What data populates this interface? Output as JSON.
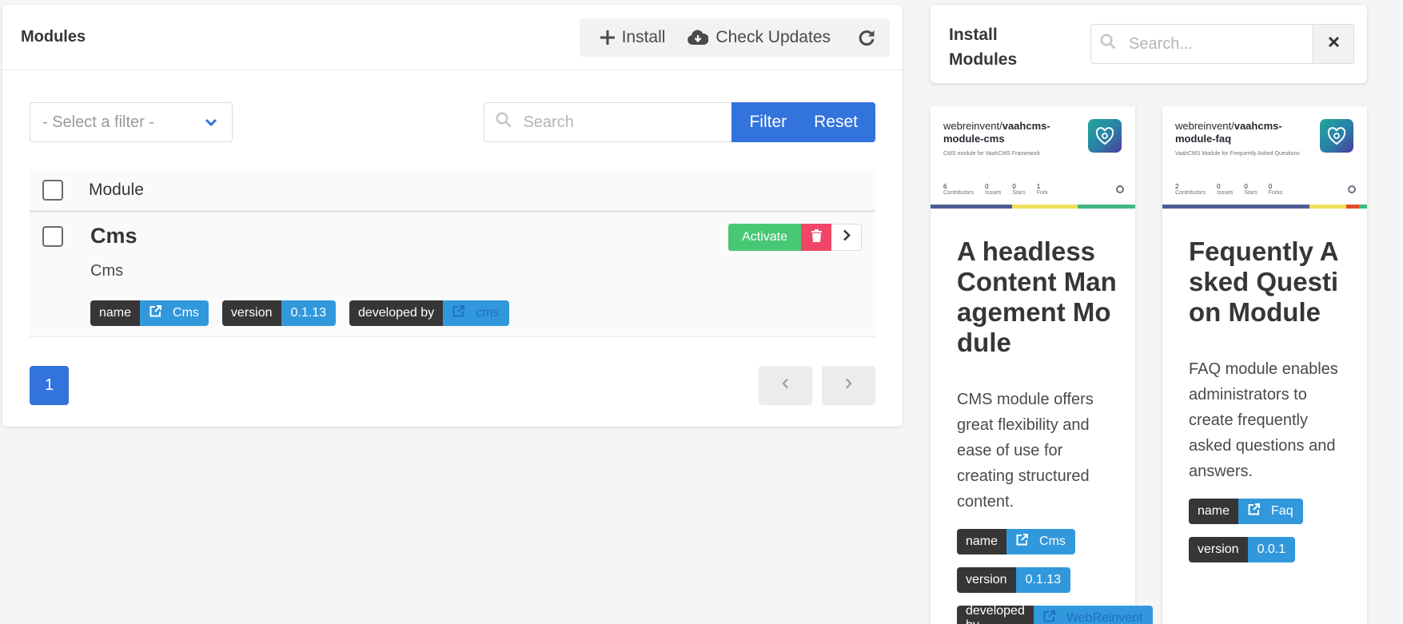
{
  "modules_panel": {
    "title": "Modules",
    "toolbar": {
      "install_label": "Install",
      "check_updates_label": "Check Updates"
    },
    "filter": {
      "select_placeholder": "- Select a filter -",
      "search_placeholder": "Search",
      "filter_label": "Filter",
      "reset_label": "Reset"
    },
    "table": {
      "column_module": "Module",
      "rows": [
        {
          "name": "Cms",
          "subtitle": "Cms",
          "activate_label": "Activate",
          "tags": [
            {
              "key": "name",
              "value": "Cms"
            },
            {
              "key": "version",
              "value": "0.1.13"
            },
            {
              "key": "developed by",
              "value": "cms"
            }
          ]
        }
      ]
    },
    "pagination": {
      "current_page": "1"
    }
  },
  "install_panel": {
    "title_line1": "Install",
    "title_line2": "Modules",
    "search_placeholder": "Search...",
    "cards": [
      {
        "repo_owner": "webreinvent/",
        "repo_name": "vaahcms-module-cms",
        "repo_desc": "CMS module for VaahCMS Framework",
        "stats": [
          {
            "value": "6",
            "label": "Contributors"
          },
          {
            "value": "0",
            "label": "Issues"
          },
          {
            "value": "0",
            "label": "Stars"
          },
          {
            "value": "1",
            "label": "Fork"
          }
        ],
        "title": "A headless Content Management Module",
        "description": "CMS module offers great flexibility and ease of use for creating structured content.",
        "tags": [
          {
            "key": "name",
            "value": "Cms"
          },
          {
            "key": "version",
            "value": "0.1.13"
          },
          {
            "key": "developed by",
            "value": "WebReinvent"
          }
        ]
      },
      {
        "repo_owner": "webreinvent/",
        "repo_name": "vaahcms-module-faq",
        "repo_desc": "VaahCMS Module for Frequently Asked Questions",
        "stats": [
          {
            "value": "2",
            "label": "Contributors"
          },
          {
            "value": "0",
            "label": "Issues"
          },
          {
            "value": "0",
            "label": "Stars"
          },
          {
            "value": "0",
            "label": "Forks"
          }
        ],
        "title": "Fequently Asked Question Module",
        "description": "FAQ module enables administrators to create frequently asked questions and answers.",
        "tags": [
          {
            "key": "name",
            "value": "Faq"
          },
          {
            "key": "version",
            "value": "0.0.1"
          }
        ]
      }
    ]
  },
  "colors": {
    "primary": "#3273dc",
    "info": "#3298dc",
    "success": "#48c774",
    "danger": "#f14668",
    "dark": "#363636"
  }
}
